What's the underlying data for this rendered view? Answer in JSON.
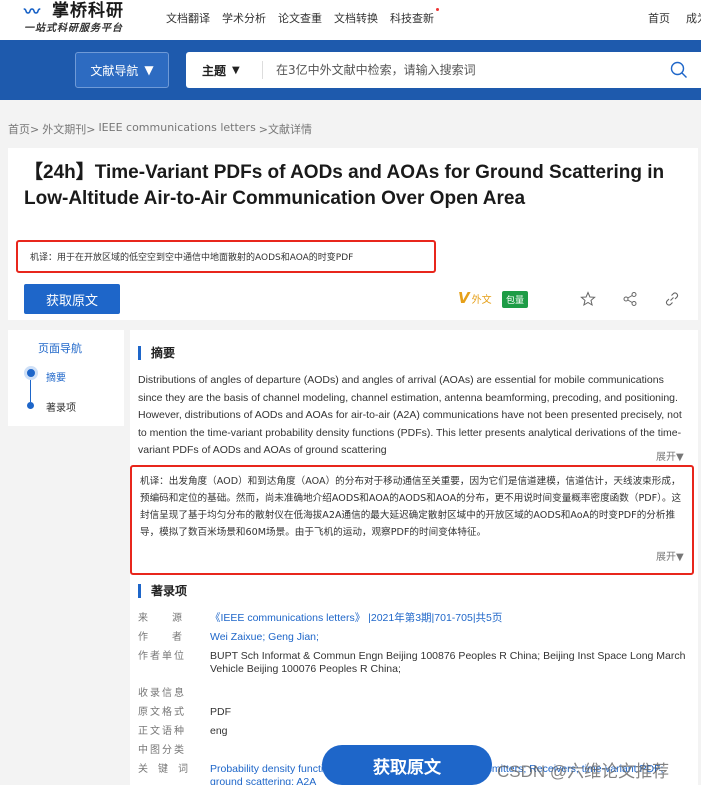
{
  "header": {
    "logo": {
      "name": "掌桥科研",
      "tagline": "一站式科研服务平台"
    },
    "nav": [
      "文档翻译",
      "学术分析",
      "论文查重",
      "文档转换",
      "科技查新"
    ],
    "right_links": [
      "首页",
      "成为"
    ]
  },
  "search": {
    "nav_button": "文献导航",
    "topic_label": "主题",
    "placeholder": "在3亿中外文献中检索，请输入搜索词"
  },
  "breadcrumb": [
    "首页>",
    "外文期刊>",
    "IEEE communications letters",
    ">文献详情"
  ],
  "article": {
    "title": "【24h】Time-Variant PDFs of AODs and AOAs for Ground Scattering in Low-Altitude Air-to-Air Communication Over Open Area",
    "machine_translation": "机译：用于在开放区域的低空空到空中通信中地面散射的AODS和AOA的时变PDF",
    "fetch_button": "获取原文",
    "waiwen_badge": "外文",
    "waiwen_mark": "V",
    "baoyuan_badge": "包量"
  },
  "left_nav": {
    "title": "页面导航",
    "items": [
      "摘要",
      "著录项"
    ]
  },
  "abstract": {
    "heading": "摘要",
    "text": "Distributions of angles of departure (AODs) and angles of arrival (AOAs) are essential for mobile communications since they are the basis of channel modeling, channel estimation, antenna beamforming, precoding, and positioning. However, distributions of AODs and AOAs for air-to-air (A2A) communications have not been presented precisely, not to mention the time-variant probability density functions (PDFs). This letter presents analytical derivations of the time-variant PDFs of AODs and AOAs of ground scattering",
    "expand": "展开▼",
    "translation": "机译：出发角度（AOD）和到达角度（AOA）的分布对于移动通信至关重要，因为它们是信道建模，信道估计，天线波束形成，预编码和定位的基础。然而，尚未准确地介绍AODS和AOA的AODS和AOA的分布，更不用说时间变量概率密度函数（PDF）。这封信呈现了基于均匀分布的散射仪在低海拔A2A通信的最大延迟确定散射区域中的开放区域的AODS和AoA的时变PDF的分析推导，模拟了数百米场景和60M场景。由于飞机的运动，观察PDF的时间变体特征。",
    "translation_expand": "展开▼"
  },
  "metadata": {
    "heading": "著录项",
    "rows": [
      {
        "label": "来源",
        "value": "《IEEE communications letters》 |2021年第3期|701-705|共5页"
      },
      {
        "label": "作者",
        "value": "Wei Zaixue; Geng Jian;"
      },
      {
        "label": "作者单位",
        "value": "BUPT Sch Informat & Commun Engn Beijing 100876 Peoples R China; Beijing Inst Space Long March Vehicle Beijing 100076 Peoples R China;"
      },
      {
        "label": "收录信息",
        "value": ""
      },
      {
        "label": "原文格式",
        "value": "PDF"
      },
      {
        "label": "正文语种",
        "value": "eng"
      },
      {
        "label": "中图分类",
        "value": ""
      },
      {
        "label": "关键词",
        "value": "Probability density functions; Channel models; Delays; Transmitters; Receivers; time-variant PDF; ground scattering; A2A"
      }
    ]
  },
  "floating": {
    "fetch_button": "获取原文",
    "watermark": "CSDN @六维论文推荐"
  },
  "colors": {
    "brand_blue": "#1e5aad",
    "accent_blue": "#1e66c9",
    "highlight_red": "#e8261c",
    "badge_green": "#1e9c46"
  }
}
